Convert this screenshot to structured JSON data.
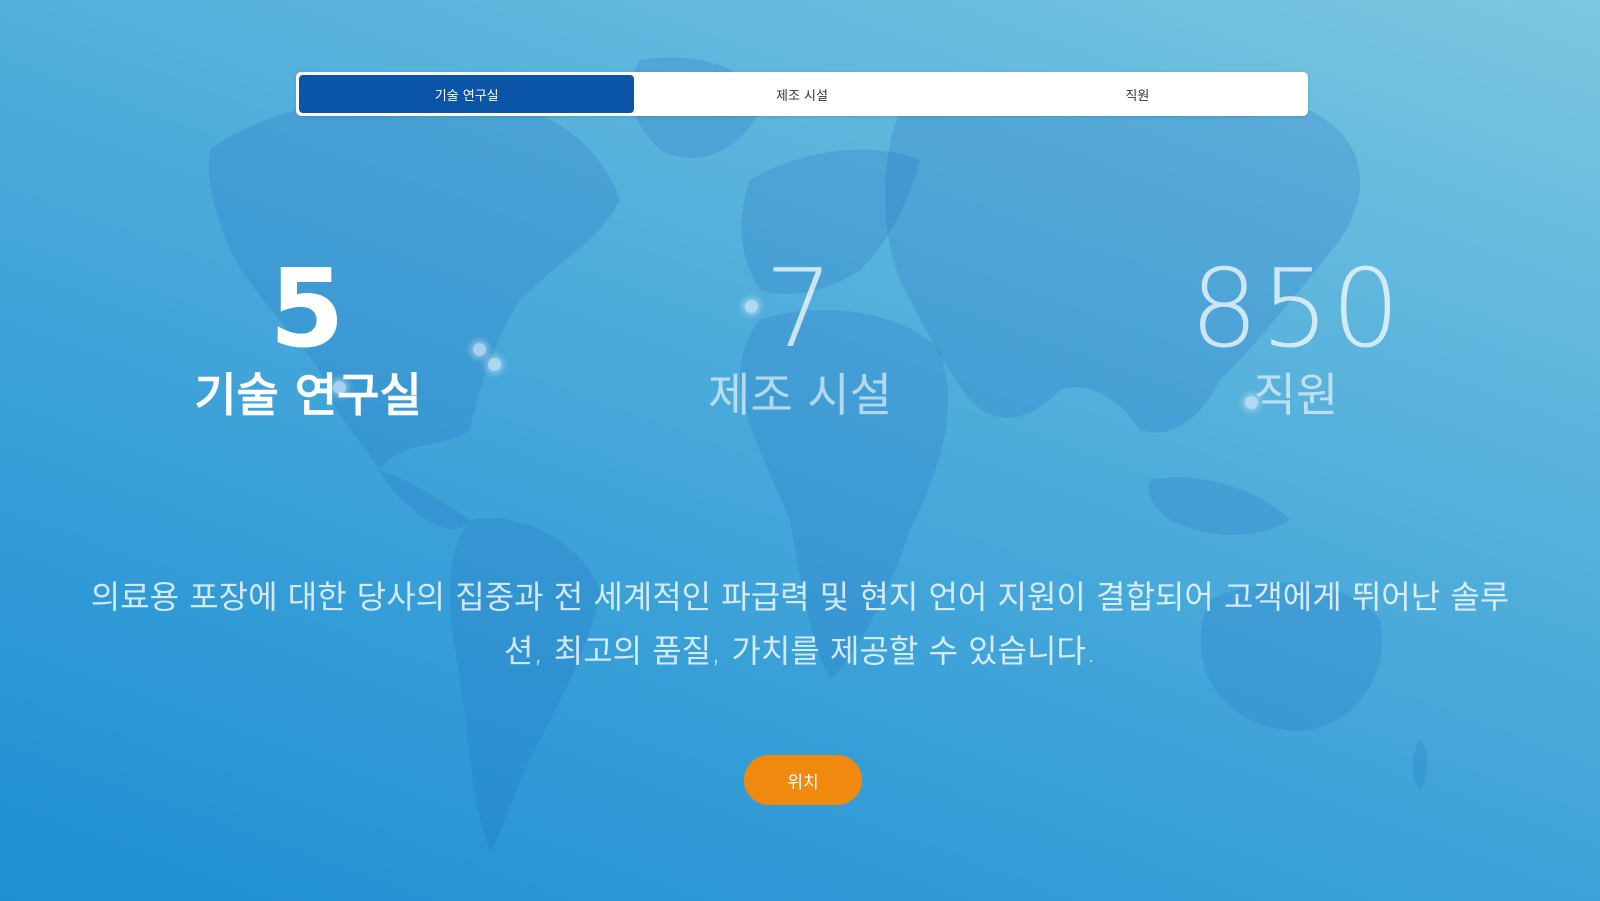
{
  "tabs": [
    {
      "label": "기술 연구실",
      "active": true
    },
    {
      "label": "제조 시설",
      "active": false
    },
    {
      "label": "직원",
      "active": false
    }
  ],
  "stats": [
    {
      "number": "5",
      "label": "기술 연구실"
    },
    {
      "number": "7",
      "label": "제조 시설"
    },
    {
      "number": "850",
      "label": "직원"
    }
  ],
  "description": "의료용 포장에 대한 당사의 집중과 전 세계적인 파급력 및 현지 언어 지원이 결합되어 고객에게 뛰어난 솔루션, 최고의 품질, 가치를 제공할 수 있습니다.",
  "location_button": "위치",
  "colors": {
    "active_tab": "#0b55a8",
    "button": "#f08a0e"
  }
}
